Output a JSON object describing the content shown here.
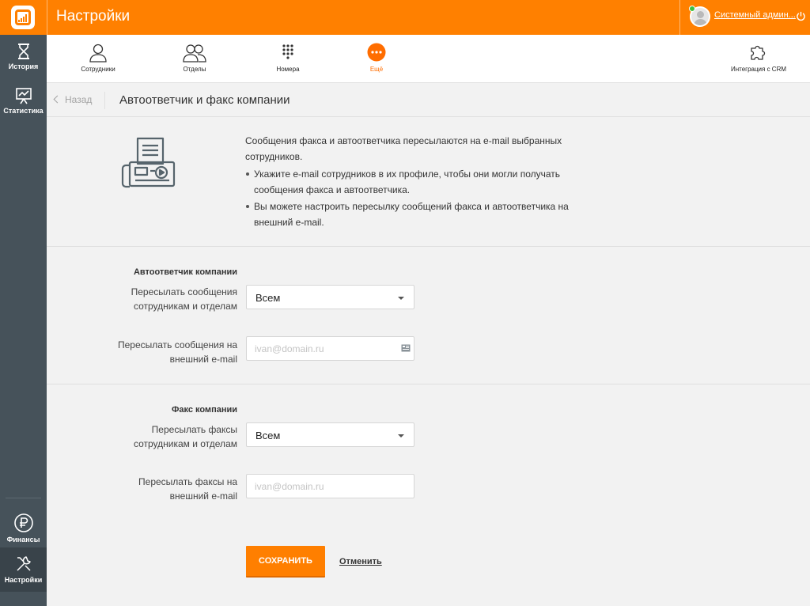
{
  "header": {
    "title": "Настройки",
    "user_name": "Системный админ...",
    "brand_color": "#ff8000"
  },
  "sidebar": {
    "items": [
      {
        "label": "История",
        "icon": "hourglass-icon"
      },
      {
        "label": "Статистика",
        "icon": "chart-board-icon"
      },
      {
        "label": "Финансы",
        "icon": "ruble-icon"
      },
      {
        "label": "Настройки",
        "icon": "tools-icon",
        "active": true
      }
    ]
  },
  "nav": {
    "items": [
      {
        "label": "Сотрудники",
        "icon": "user-icon"
      },
      {
        "label": "Отделы",
        "icon": "users-icon"
      },
      {
        "label": "Номера",
        "icon": "dialpad-icon"
      },
      {
        "label": "Ещё",
        "icon": "more-icon",
        "active": true
      },
      {
        "label": "Интеграция с CRM",
        "icon": "puzzle-icon"
      }
    ]
  },
  "subheader": {
    "back_label": "Назад",
    "title": "Автоответчик и факс компании"
  },
  "info": {
    "intro": "Сообщения факса и автоответчика пересылаются на e-mail выбранных сотрудников.",
    "bullets": [
      "Укажите e-mail сотрудников в их профиле, чтобы они могли получать сообщения факса и автоответчика.",
      "Вы можете настроить пересылку сообщений факса и автоответчика на внешний e-mail."
    ]
  },
  "autoresponder": {
    "section_title": "Автоответчик компании",
    "forward_employees_label": "Пересылать сообщения сотрудникам и отделам",
    "forward_employees_value": "Всем",
    "forward_email_label": "Пересылать сообщения на внешний e-mail",
    "forward_email_placeholder": "ivan@domain.ru",
    "forward_email_value": ""
  },
  "fax": {
    "section_title": "Факс компании",
    "forward_employees_label": "Пересылать факсы сотрудникам и отделам",
    "forward_employees_value": "Всем",
    "forward_email_label": "Пересылать факсы на внешний e-mail",
    "forward_email_placeholder": "ivan@domain.ru",
    "forward_email_value": ""
  },
  "actions": {
    "save_label": "СОХРАНИТЬ",
    "cancel_label": "Отменить"
  }
}
